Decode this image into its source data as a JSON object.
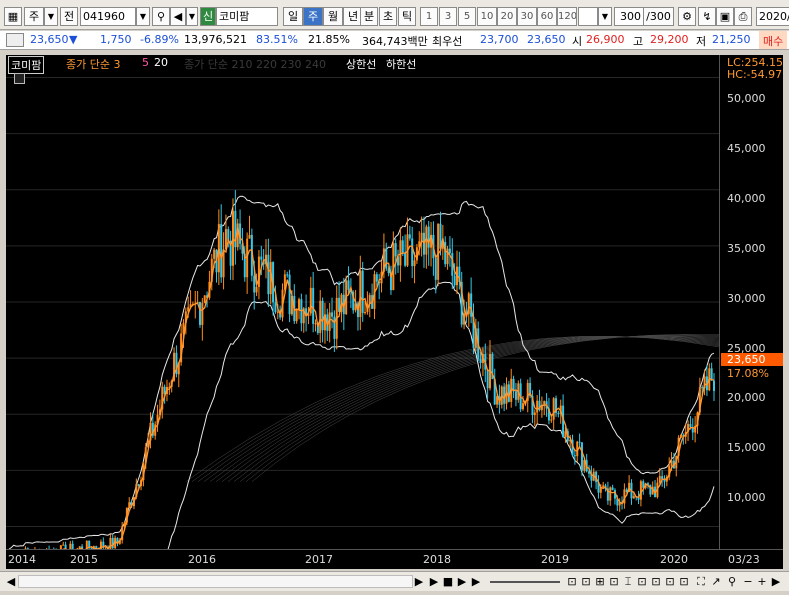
{
  "toolbar": {
    "period": "주",
    "prev": "전",
    "code": "041960",
    "arrow": "▼",
    "sin": "신",
    "stock_name": "코미팜",
    "periods": [
      "일",
      "주",
      "월",
      "년"
    ],
    "minutes": [
      "분",
      "초",
      "틱"
    ],
    "intervals": [
      "1",
      "3",
      "5",
      "10",
      "20",
      "30",
      "60",
      "120"
    ],
    "count": "300",
    "count_total": "/300",
    "date": "2020/"
  },
  "quote": {
    "price": "23,650",
    "change_arrow": "▼",
    "change": "1,750",
    "pct": "-6.89%",
    "volume": "13,976,521",
    "ratio": "83.51%",
    "turn": "21.85%",
    "amount": "364,743백만",
    "order_label": "최우선",
    "ask": "23,700",
    "bid": "23,650",
    "open_label": "시",
    "open": "26,900",
    "high_label": "고",
    "high": "29,200",
    "low_label": "저",
    "low": "21,250",
    "side": "매수"
  },
  "legend": {
    "name": "코미팜",
    "ma_label": "종가 단순 3",
    "ma5": "5",
    "ma20": "20",
    "ma_long": "종가 단순 210 220 230 240",
    "upper": "상한선",
    "lower": "하한선"
  },
  "price_axis": {
    "lc": "LC:254.15",
    "hc": "HC:-54.97",
    "ticks": [
      "50,000",
      "45,000",
      "40,000",
      "35,000",
      "30,000",
      "25,000",
      "20,000",
      "15,000",
      "10,000"
    ],
    "current": "23,650",
    "current_pct": "17.08%"
  },
  "x_axis": {
    "years": [
      "2014",
      "2015",
      "2016",
      "2017",
      "2018",
      "2019",
      "2020"
    ],
    "date": "03/23"
  },
  "colors": {
    "up": "#ff8c1a",
    "down": "#35c8e8",
    "ma": "#ff9933",
    "band": "#ffffff",
    "axis_text": "#dddddd",
    "highlight": "#ff5a00"
  },
  "chart_data": {
    "type": "candlestick",
    "x": [
      "2014",
      "2014.5",
      "2015",
      "2015.5",
      "2016",
      "2016.5",
      "2017",
      "2017.5",
      "2018",
      "2018.5",
      "2019",
      "2019.5",
      "2020",
      "2020.2"
    ],
    "close": [
      7500,
      7800,
      8500,
      24000,
      36000,
      31000,
      29000,
      33000,
      34500,
      22000,
      21000,
      12500,
      13500,
      23650
    ],
    "y_min": 8000,
    "y_max": 52000
  }
}
